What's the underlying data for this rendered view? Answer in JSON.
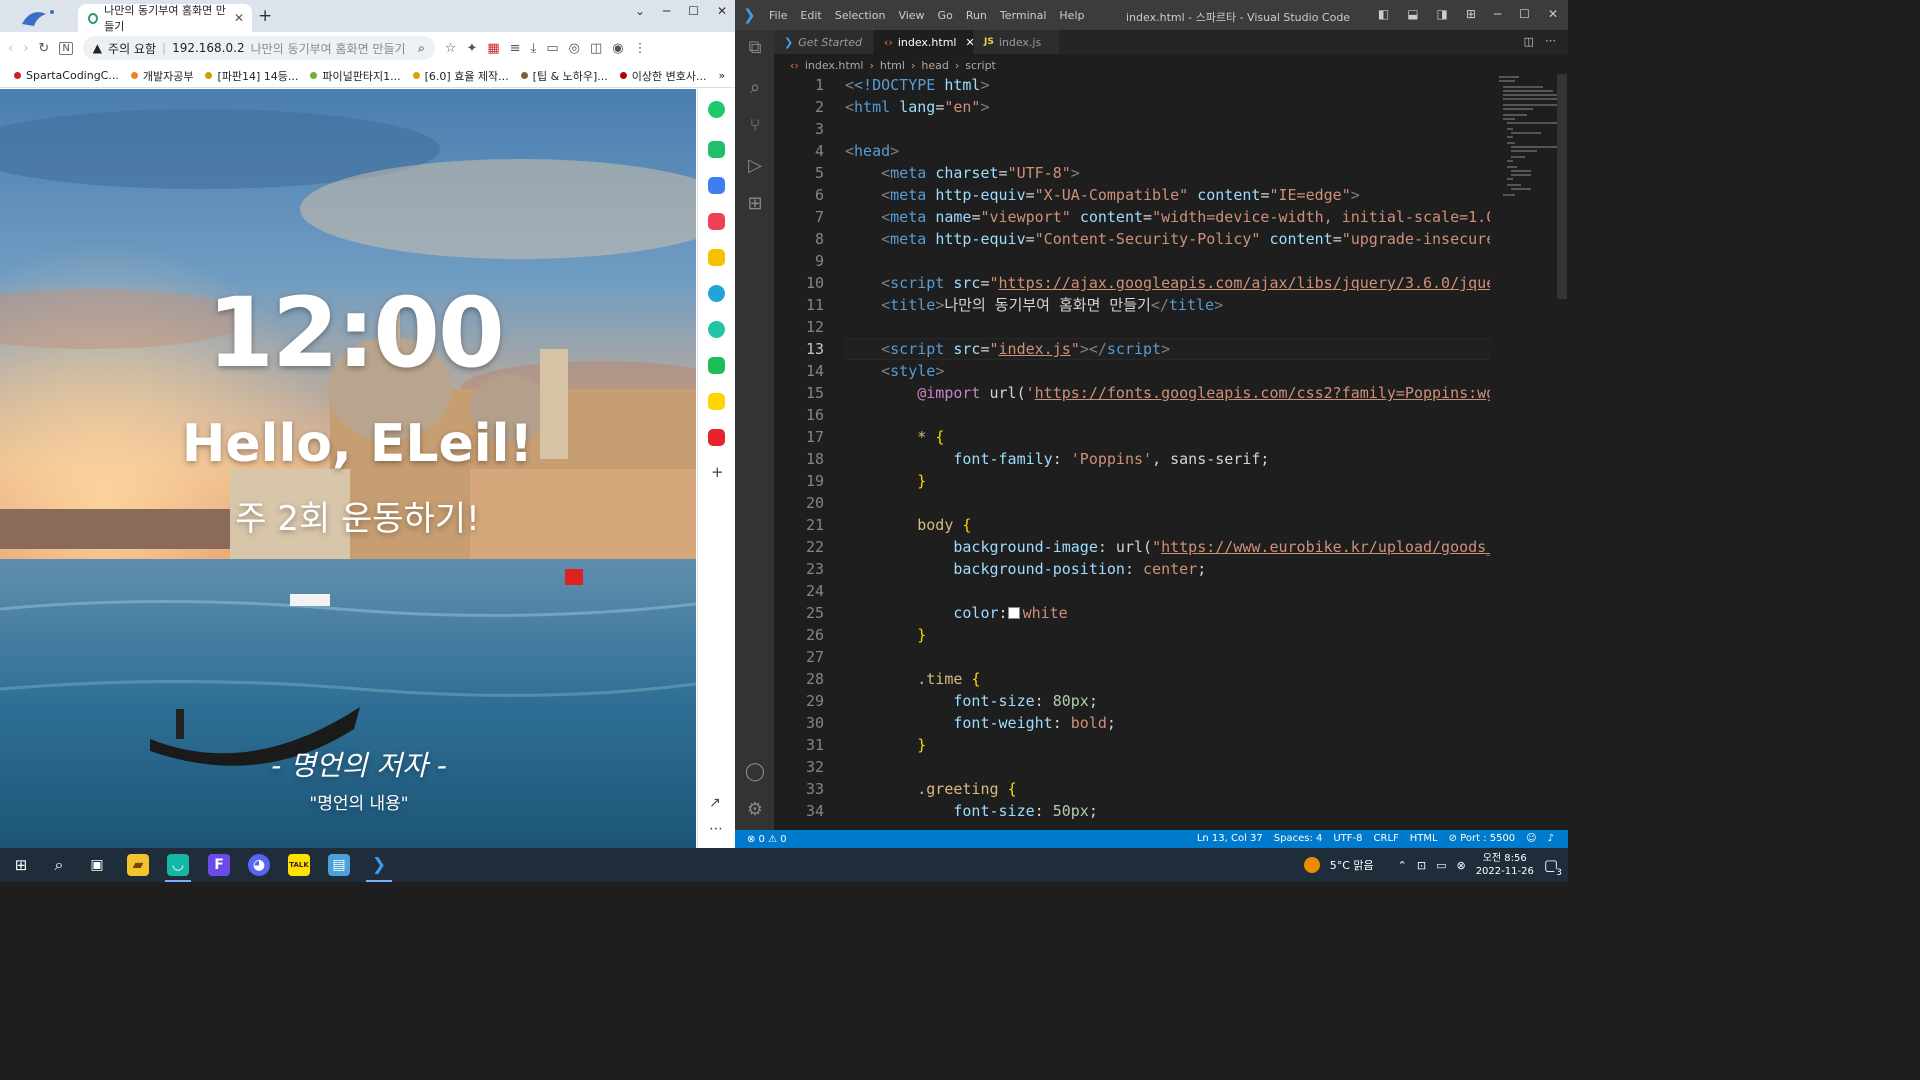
{
  "browser": {
    "tab_title": "나만의 동기부여 홈화면 만들기",
    "security_text": "주의 요함",
    "url_host": "192.168.0.2",
    "url_title": "나만의 동기부여 홈화면 만들기",
    "bookmarks": [
      "SpartaCodingC...",
      "개발자공부",
      "[파판14] 14등...",
      "파이널판타지1...",
      "[6.0] 효율 제작...",
      "[팁 & 노하우]...",
      "이상한 변호사..."
    ],
    "bookmark_colors": [
      "#d02020",
      "#f08020",
      "#c9a200",
      "#70b030",
      "#e0a000",
      "#806030",
      "#b00000"
    ]
  },
  "page": {
    "clock": "12:00",
    "greeting": "Hello, ELeil!",
    "goal": "주 2회 운동하기!",
    "quote_author": "- 명언의 저자 -",
    "quote_content": "\"명언의 내용\""
  },
  "vscode": {
    "menu": [
      "File",
      "Edit",
      "Selection",
      "View",
      "Go",
      "Run",
      "Terminal",
      "Help"
    ],
    "window_title": "index.html - 스파르타 - Visual Studio Code",
    "tabs": [
      "Get Started",
      "index.html",
      "index.js"
    ],
    "breadcrumb": [
      "index.html",
      "html",
      "head",
      "script"
    ],
    "code": {
      "l1_doctype": "<!DOCTYPE ",
      "l1_html": "html",
      "l2_lang_value": "\"en\"",
      "l5_charset": "\"UTF-8\"",
      "l6_equiv": "\"X-UA-Compatible\"",
      "l6_content": "\"IE=edge\"",
      "l7_name": "\"viewport\"",
      "l7_content": "\"width=device-width, initial-scale=1.0",
      "l8_equiv": "\"Content-Security-Policy\"",
      "l8_content": "\"upgrade-insecure",
      "l10_src": "https://ajax.googleapis.com/ajax/libs/jquery/3.6.0/jque",
      "l11_title": "나만의 동기부여 홈화면 만들기",
      "l13_src": "index.js",
      "l15_import": "https://fonts.googleapis.com/css2?family=Poppins:wg",
      "l18_family": "'Poppins'",
      "l22_url": "https://www.eurobike.kr/upload/goods_",
      "l23_pos": "center",
      "l25_color": "white",
      "l29_size": "80px",
      "l30_weight": "bold",
      "l34_size": "50px"
    }
  },
  "status": {
    "problems": "⊗ 0 ⚠ 0",
    "position": "Ln 13, Col 37",
    "spaces": "Spaces: 4",
    "encoding": "UTF-8",
    "eol": "CRLF",
    "language": "HTML",
    "port": "⊘ Port : 5500"
  },
  "taskbar": {
    "weather": "5°C 맑음",
    "time": "오전 8:56",
    "date": "2022-11-26",
    "notifications": "3"
  }
}
